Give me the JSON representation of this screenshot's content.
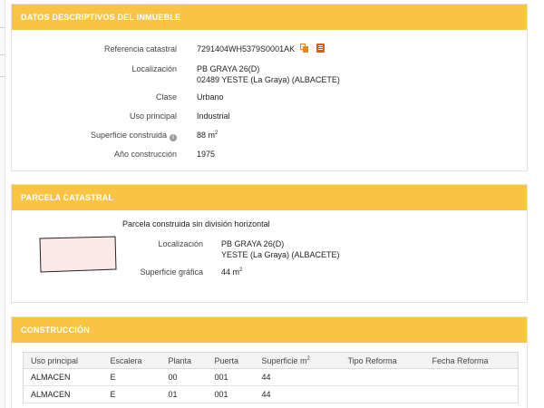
{
  "section1": {
    "title": "DATOS DESCRIPTIVOS DEL INMUEBLE",
    "referencia": {
      "label": "Referencia catastral",
      "value": "7291404WH5379S0001AK"
    },
    "localizacion": {
      "label": "Localización",
      "line1": "PB GRAYA 26(D)",
      "line2": "02489 YESTE (La Graya) (ALBACETE)"
    },
    "clase": {
      "label": "Clase",
      "value": "Urbano"
    },
    "uso": {
      "label": "Uso principal",
      "value": "Industrial"
    },
    "superficie": {
      "label": "Superficie construida",
      "value": "88 m",
      "unit_sup": "2"
    },
    "anio": {
      "label": "Año construcción",
      "value": "1975"
    }
  },
  "section2": {
    "title": "PARCELA CATASTRAL",
    "subtitle": "Parcela construida sin división horizontal",
    "localizacion": {
      "label": "Localización",
      "line1": "PB GRAYA 26(D)",
      "line2": "YESTE (La Graya) (ALBACETE)"
    },
    "superficie": {
      "label": "Superficie gráfica",
      "value": "44 m",
      "unit_sup": "2"
    }
  },
  "section3": {
    "title": "CONSTRUCCIÓN",
    "columns": [
      "Uso principal",
      "Escalera",
      "Planta",
      "Puerta",
      "Superficie m",
      "Tipo Reforma",
      "Fecha Reforma"
    ],
    "superficie_sup": "2",
    "rows": [
      [
        "ALMACEN",
        "E",
        "00",
        "001",
        "44",
        "",
        ""
      ],
      [
        "ALMACEN",
        "E",
        "01",
        "001",
        "44",
        "",
        ""
      ]
    ]
  },
  "colors": {
    "header": "#f9c443",
    "parcel_fill": "#fde8e8",
    "icon_orange": "#e08a1e"
  },
  "icons": [
    "copy-icon",
    "book-icon",
    "info-icon"
  ]
}
